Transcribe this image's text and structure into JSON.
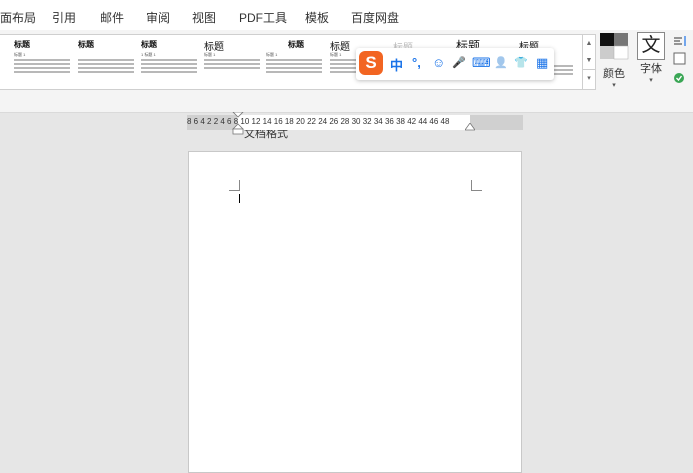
{
  "menu": {
    "items": [
      "面布局",
      "引用",
      "邮件",
      "审阅",
      "视图",
      "PDF工具",
      "模板",
      "百度网盘"
    ]
  },
  "ribbon": {
    "styles": [
      {
        "heading": "标题",
        "sub": "标题 1"
      },
      {
        "heading": "标题",
        "sub": ""
      },
      {
        "heading": "标题",
        "sub": "1 标题 1"
      },
      {
        "heading": "标题",
        "sub": "标题 1"
      },
      {
        "heading": "标题",
        "sub": "标题 1"
      },
      {
        "heading": "标题",
        "sub": "标题 1"
      },
      {
        "heading": "标题",
        "sub": ""
      },
      {
        "heading": "标题",
        "sub": ""
      },
      {
        "heading": "标题",
        "sub": ""
      }
    ],
    "colors_label": "颜色",
    "fonts_glyph": "文",
    "fonts_label": "字体",
    "group_label": "文档格式"
  },
  "ime": {
    "logo": "S",
    "buttons": [
      "中",
      "°,",
      "☺",
      "🎤",
      "⌨",
      "👤",
      "👕",
      "▦"
    ]
  },
  "ruler": {
    "numbers": "8  6  4  2       2  4  6  8 10 12 14 16 18 20 22 24 26 28 30 32 34 36 38     42 44 46 48"
  },
  "colors": {
    "accent_blue": "#1a73e8",
    "sogou_orange": "#f26522"
  }
}
